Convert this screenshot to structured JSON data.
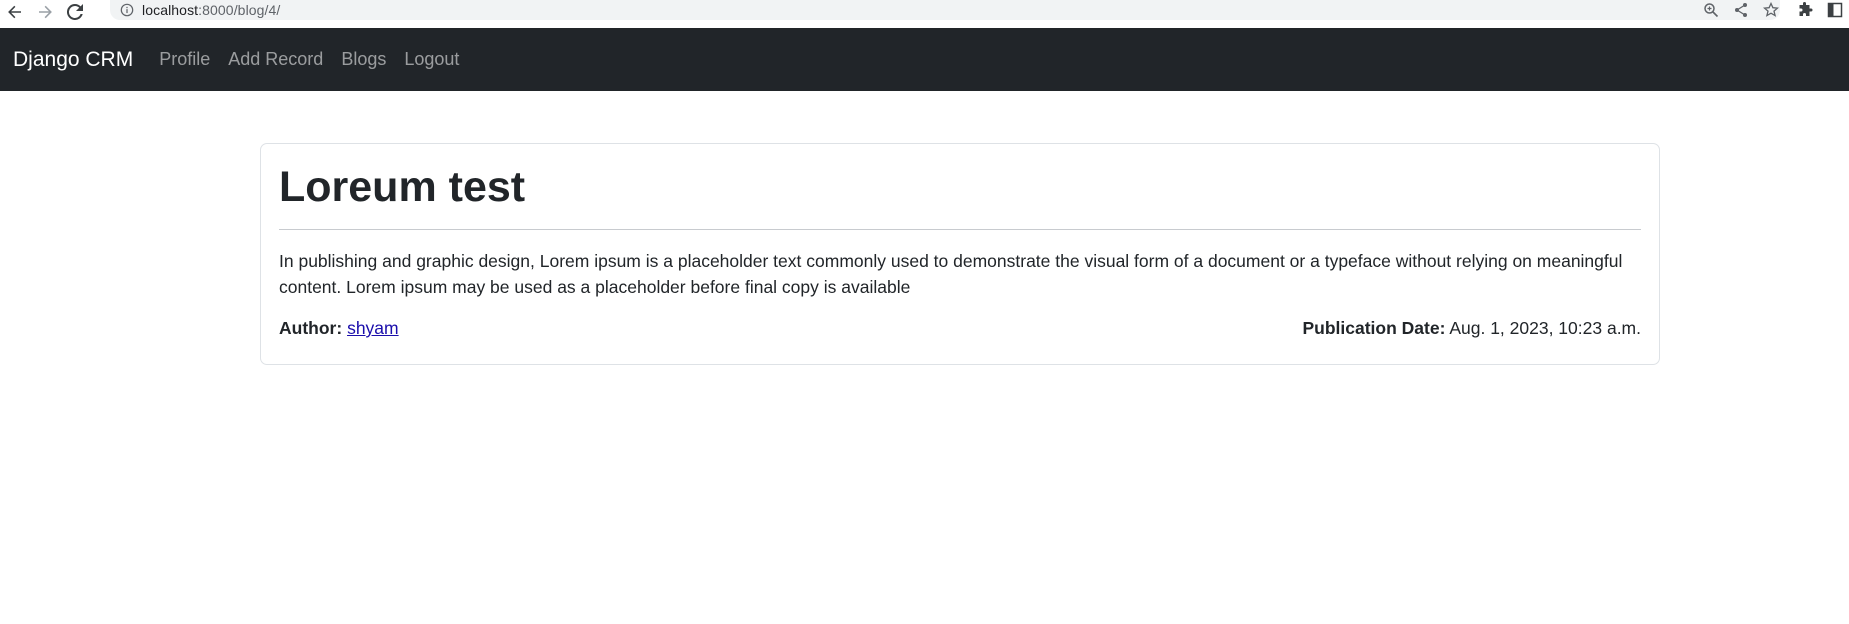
{
  "browser": {
    "url_host": "localhost",
    "url_rest": ":8000/blog/4/"
  },
  "navbar": {
    "brand": "Django CRM",
    "links": [
      "Profile",
      "Add Record",
      "Blogs",
      "Logout"
    ]
  },
  "post": {
    "title": "Loreum test",
    "body": "In publishing and graphic design, Lorem ipsum is a placeholder text commonly used to demonstrate the visual form of a document or a typeface without relying on meaningful content. Lorem ipsum may be used as a placeholder before final copy is available",
    "author_label": "Author:",
    "author": "shyam",
    "date_label": "Publication Date:",
    "date": "Aug. 1, 2023, 10:23 a.m."
  },
  "colors": {
    "navbar_bg": "#212529",
    "link": "#1a0dab"
  }
}
